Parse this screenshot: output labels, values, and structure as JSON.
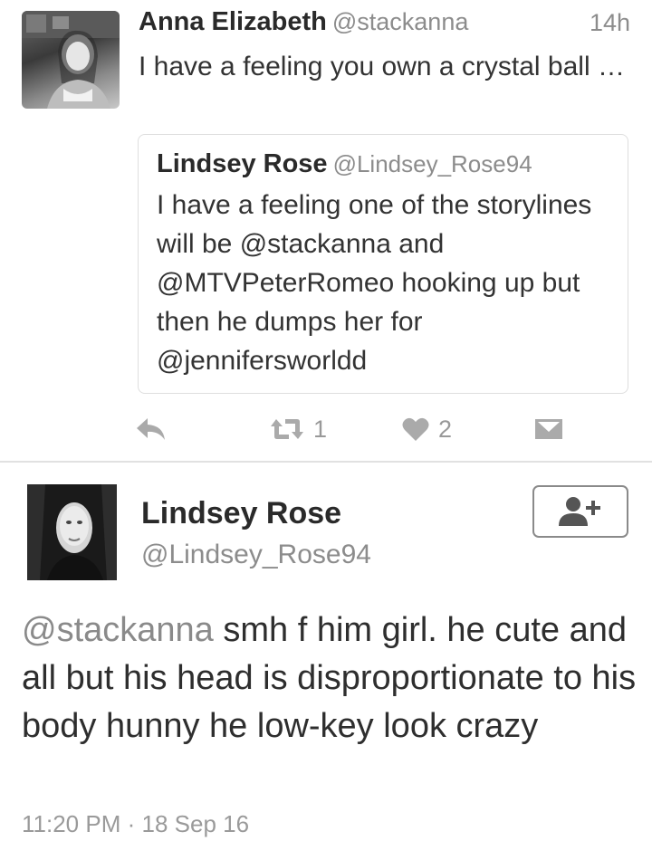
{
  "reply_tweet": {
    "author_name": "Anna Elizabeth",
    "author_handle": "@stackanna",
    "timestamp": "14h",
    "text": "I have a feeling you own a crystal ball …",
    "quoted_tweet": {
      "author_name": "Lindsey Rose",
      "author_handle": "@Lindsey_Rose94",
      "text": "I have a feeling one of the storylines will be @stackanna and @MTVPeterRomeo hooking up but then he dumps her for @jennifersworldd"
    },
    "actions": {
      "reply_icon": "reply-arrow",
      "retweet_icon": "retweet-arrows",
      "retweet_count": "1",
      "like_icon": "heart",
      "like_count": "2",
      "dm_icon": "envelope"
    }
  },
  "main_tweet": {
    "author_name": "Lindsey Rose",
    "author_handle": "@Lindsey_Rose94",
    "follow_icon": "add-user",
    "mention": "@stackanna",
    "text": " smh f him girl. he cute and all but his head is disproportionate to his body hunny he low-key look crazy",
    "time": "11:20 PM",
    "separator": "·",
    "date": "18 Sep 16"
  },
  "colors": {
    "text": "#333333",
    "muted": "#8c8c8c",
    "border": "#dedede",
    "icon": "#aaaaaa"
  }
}
